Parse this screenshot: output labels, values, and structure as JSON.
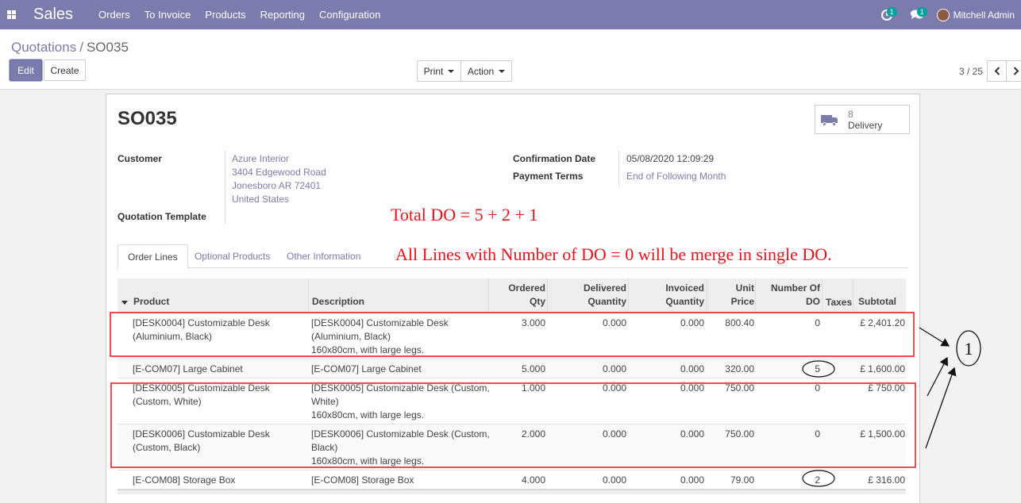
{
  "app": {
    "name": "Sales"
  },
  "menu": [
    "Orders",
    "To Invoice",
    "Products",
    "Reporting",
    "Configuration"
  ],
  "systray": {
    "activity_count": "1",
    "message_count": "1",
    "user_name": "Mitchell Admin"
  },
  "breadcrumb": {
    "parent": "Quotations",
    "separator": "/",
    "current": "SO035"
  },
  "buttons": {
    "edit": "Edit",
    "create": "Create",
    "print": "Print",
    "action": "Action"
  },
  "pager": {
    "value": "3 / 25"
  },
  "record": {
    "name": "SO035",
    "delivery_count": "8",
    "delivery_label": "Delivery",
    "customer_label": "Customer",
    "customer_lines": [
      "Azure Interior",
      "3404 Edgewood Road",
      "Jonesboro AR 72401",
      "United States"
    ],
    "template_label": "Quotation Template",
    "confirmation_label": "Confirmation Date",
    "confirmation_value": "05/08/2020 12:09:29",
    "payment_label": "Payment Terms",
    "payment_value": "End of Following Month"
  },
  "annotations": {
    "total": "Total DO = 5 + 2 + 1",
    "merge": "All Lines with Number of DO = 0 will be merge in single DO.",
    "circle_label": "1"
  },
  "tabs": [
    "Order Lines",
    "Optional Products",
    "Other Information"
  ],
  "table": {
    "headers": {
      "product": "Product",
      "description": "Description",
      "ordered": [
        "Ordered",
        "Qty"
      ],
      "delivered": [
        "Delivered",
        "Quantity"
      ],
      "invoiced": [
        "Invoiced",
        "Quantity"
      ],
      "price": [
        "Unit",
        "Price"
      ],
      "ndo": [
        "Number Of",
        "DO"
      ],
      "taxes": "Taxes",
      "subtotal": "Subtotal"
    },
    "rows": [
      {
        "product": [
          "[DESK0004] Customizable Desk",
          "(Aluminium, Black)"
        ],
        "description": [
          "[DESK0004] Customizable Desk",
          "(Aluminium, Black)",
          "160x80cm, with large legs."
        ],
        "ordered": "3.000",
        "delivered": "0.000",
        "invoiced": "0.000",
        "price": "800.40",
        "ndo": "0",
        "subtotal": "£ 2,401.20"
      },
      {
        "product": [
          "[E-COM07] Large Cabinet"
        ],
        "description": [
          "[E-COM07] Large Cabinet"
        ],
        "ordered": "5.000",
        "delivered": "0.000",
        "invoiced": "0.000",
        "price": "320.00",
        "ndo": "5",
        "subtotal": "£ 1,600.00"
      },
      {
        "product": [
          "[DESK0005] Customizable Desk",
          "(Custom, White)"
        ],
        "description": [
          "[DESK0005] Customizable Desk (Custom,",
          "White)",
          "160x80cm, with large legs."
        ],
        "ordered": "1.000",
        "delivered": "0.000",
        "invoiced": "0.000",
        "price": "750.00",
        "ndo": "0",
        "subtotal": "£ 750.00"
      },
      {
        "product": [
          "[DESK0006] Customizable Desk",
          "(Custom, Black)"
        ],
        "description": [
          "[DESK0006] Customizable Desk (Custom,",
          "Black)",
          "160x80cm, with large legs."
        ],
        "ordered": "2.000",
        "delivered": "0.000",
        "invoiced": "0.000",
        "price": "750.00",
        "ndo": "0",
        "subtotal": "£ 1,500.00"
      },
      {
        "product": [
          "[E-COM08] Storage Box"
        ],
        "description": [
          "[E-COM08] Storage Box"
        ],
        "ordered": "4.000",
        "delivered": "0.000",
        "invoiced": "0.000",
        "price": "79.00",
        "ndo": "2",
        "subtotal": "£ 316.00"
      }
    ]
  },
  "colors": {
    "brand": "#7c7bad",
    "annotation": "#e8121b"
  }
}
